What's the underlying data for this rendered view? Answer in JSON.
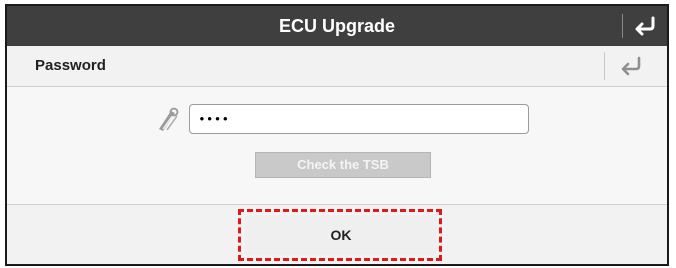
{
  "window": {
    "title": "ECU Upgrade"
  },
  "section": {
    "label": "Password"
  },
  "password": {
    "value": "••••"
  },
  "buttons": {
    "check_tsb": "Check the TSB",
    "ok": "OK"
  },
  "icons": {
    "title_back": "return-arrow-icon",
    "section_back": "return-arrow-icon",
    "key": "key-icon"
  },
  "colors": {
    "titlebar": "#3f3f3f",
    "highlight": "#e01818",
    "disabled_button": "#c9c9c9"
  },
  "states": {
    "check_tsb_enabled": false
  }
}
